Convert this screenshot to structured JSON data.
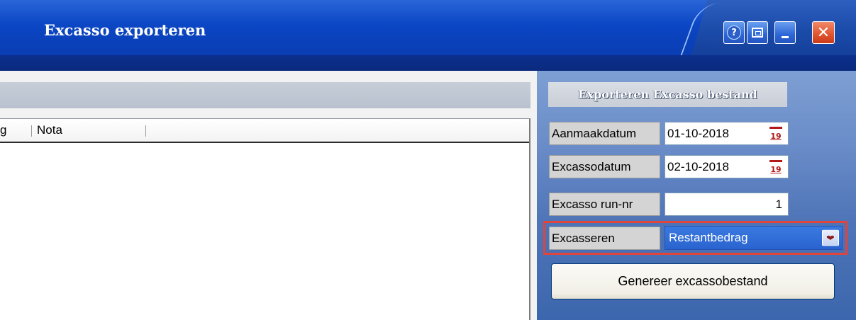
{
  "window": {
    "title": "Excasso exporteren",
    "controls": {
      "help": "?",
      "close": "✕"
    }
  },
  "grid": {
    "columns": [
      {
        "label": "g"
      },
      {
        "label": "Nota"
      }
    ]
  },
  "panel": {
    "header": "Exporteren Excasso bestand",
    "fields": {
      "aanmaakdatum": {
        "label": "Aanmaakdatum",
        "value": "01-10-2018",
        "icon": "calendar-icon",
        "icon_text": "19"
      },
      "excassodatum": {
        "label": "Excassodatum",
        "value": "02-10-2018",
        "icon": "calendar-icon",
        "icon_text": "19"
      },
      "run_nr": {
        "label": "Excasso run-nr",
        "value": "1"
      },
      "excasseren": {
        "label": "Excasseren",
        "value": "Restantbedrag",
        "icon": "chevron-down-icon"
      }
    },
    "button": "Genereer excassobestand"
  },
  "colors": {
    "titlebar": "#0b46c4",
    "strip": "#0a2a7e",
    "panel": "#4f75b8",
    "highlight_outline": "#e0443a",
    "close_button": "#e0532e",
    "select_bg": "#2a63cf"
  }
}
